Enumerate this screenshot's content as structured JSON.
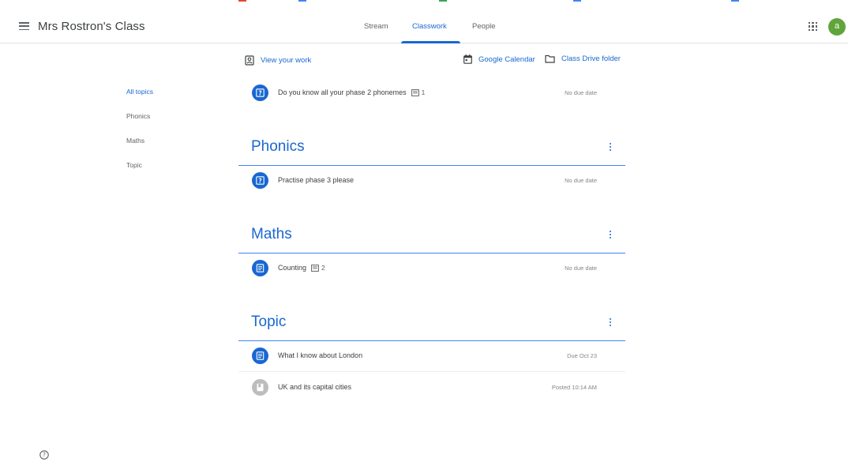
{
  "header": {
    "class_title": "Mrs Rostron's Class",
    "avatar_letter": "a",
    "avatar_color": "#5fa53b"
  },
  "tabs": [
    {
      "label": "Stream"
    },
    {
      "label": "Classwork"
    },
    {
      "label": "People"
    }
  ],
  "active_tab": "Classwork",
  "links": {
    "view_work": "View your work",
    "calendar": "Google Calendar",
    "drive": "Class Drive folder"
  },
  "topics_nav": [
    {
      "label": "All topics"
    },
    {
      "label": "Phonics"
    },
    {
      "label": "Maths"
    },
    {
      "label": "Topic"
    }
  ],
  "ungrouped_items": [
    {
      "title": "Do you know all your phase 2 phonemes",
      "comments": "1",
      "due": "No due date",
      "icon": "question-icon"
    }
  ],
  "sections": [
    {
      "title": "Phonics",
      "items": [
        {
          "title": "Practise phase 3 please",
          "comments": "",
          "due": "No due date",
          "icon": "question-icon"
        }
      ]
    },
    {
      "title": "Maths",
      "items": [
        {
          "title": "Counting",
          "comments": "2",
          "due": "No due date",
          "icon": "assignment-icon"
        }
      ]
    },
    {
      "title": "Topic",
      "items": [
        {
          "title": "What I know about London",
          "comments": "",
          "due": "Due Oct 23",
          "icon": "assignment-icon"
        },
        {
          "title": "UK and its capital cities",
          "comments": "",
          "due": "Posted 10:14 AM",
          "icon": "material-icon"
        }
      ]
    }
  ],
  "colors": {
    "accent": "#1967d2",
    "text": "#3c4043",
    "muted": "#80868b"
  }
}
